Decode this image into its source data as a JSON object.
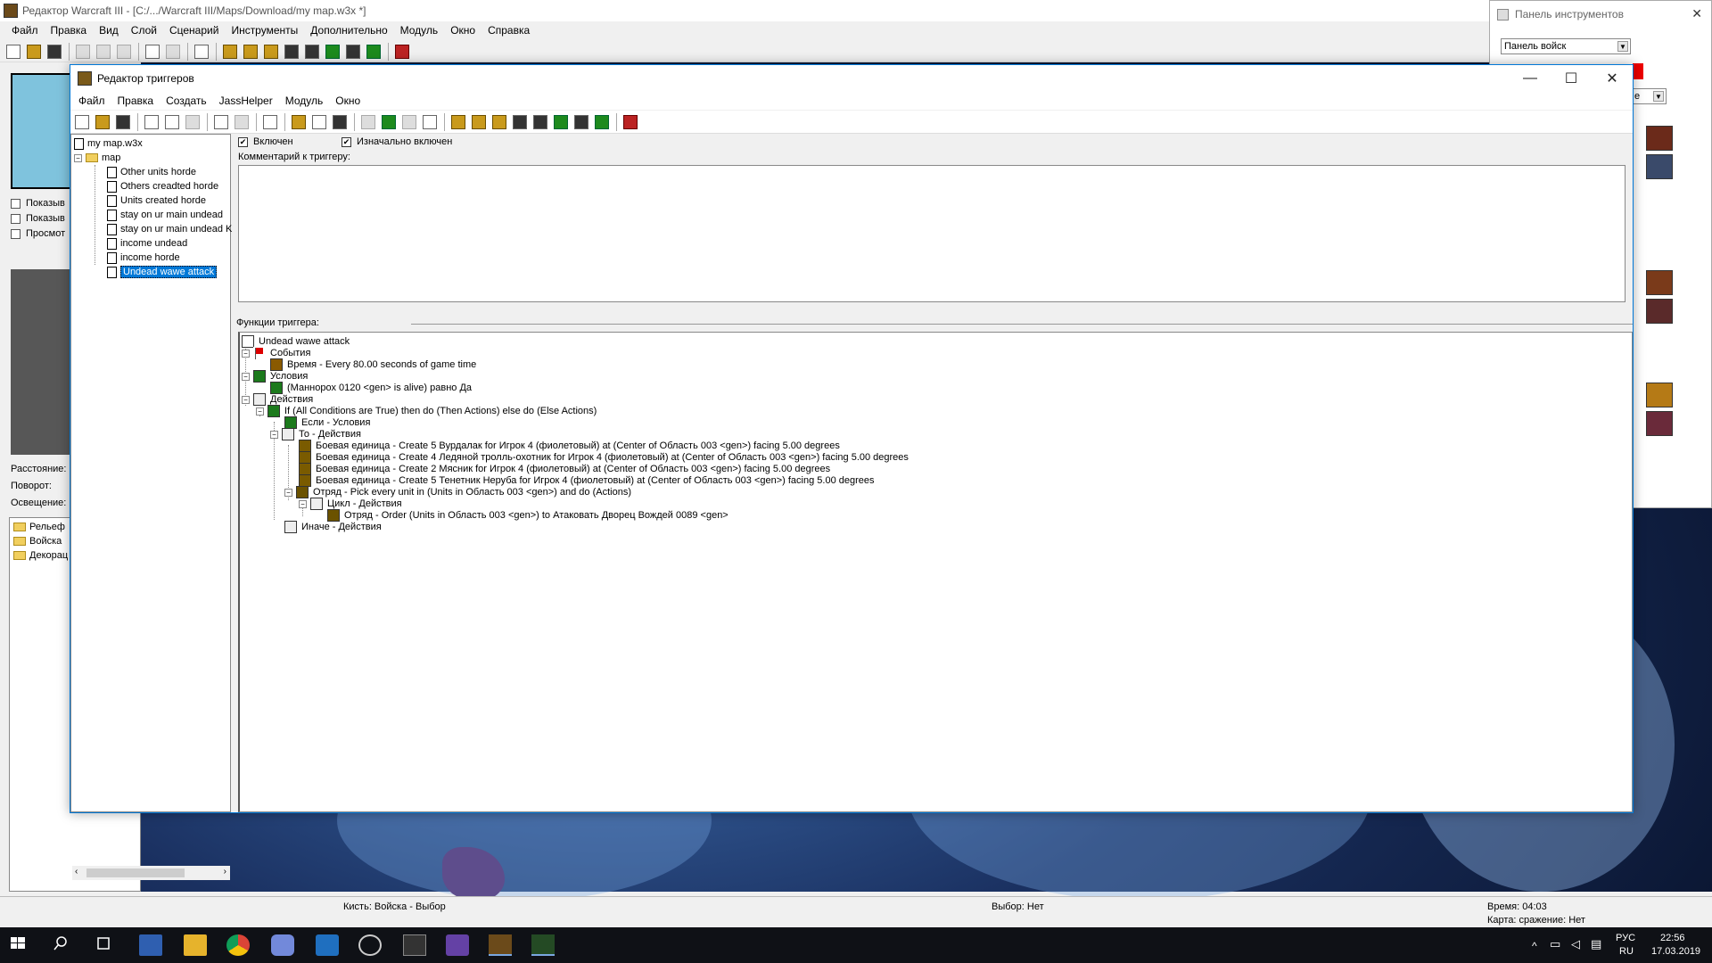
{
  "main_window": {
    "title": "Редактор Warcraft III  - [C:/.../Warcraft III/Maps/Download/my map.w3x *]",
    "menu": [
      "Файл",
      "Правка",
      "Вид",
      "Слой",
      "Сценарий",
      "Инструменты",
      "Дополнительно",
      "Модуль",
      "Окно",
      "Справка"
    ],
    "left_checks": [
      "Показыв",
      "Показыв",
      "Просмот"
    ],
    "props": [
      "Расстояние:",
      "Поворот:",
      "Освещение:"
    ],
    "palette": [
      "Рельеф",
      "Войска",
      "Декорац"
    ]
  },
  "tool_panel": {
    "title": "Панель инструментов",
    "select_value": "Панель войск",
    "second_select_fragment": "е"
  },
  "trigger_editor": {
    "title": "Редактор триггеров",
    "menu": [
      "Файл",
      "Правка",
      "Создать",
      "JassHelper",
      "Модуль",
      "Окно"
    ],
    "enabled_label": "Включен",
    "initially_on_label": "Изначально включен",
    "comment_label": "Комментарий к триггеру:",
    "functions_label": "Функции триггера:",
    "tree": {
      "root": "my map.w3x",
      "folder": "map",
      "triggers": [
        "Other units horde",
        "Others creadted horde",
        "Units created horde",
        "stay on ur main undead",
        "stay on ur main undead K",
        "income undead",
        "income horde",
        "Undead wawe attack"
      ]
    },
    "functions": {
      "trigger_name": "Undead wawe attack",
      "events_label": "События",
      "event_1": "Время - Every 80.00 seconds of game time",
      "conditions_label": "Условия",
      "condition_1": "(Маннорох 0120 <gen> is alive) равно Да",
      "actions_label": "Действия",
      "if_action": "If (All Conditions are True) then do (Then Actions) else do (Else Actions)",
      "if_conditions": "Если - Условия",
      "then_actions": "То - Действия",
      "unit_1": "Боевая единица - Create 5 Вурдалак for Игрок 4 (фиолетовый) at (Center of Область 003 <gen>) facing 5.00 degrees",
      "unit_2": "Боевая единица - Create 4 Ледяной тролль-охотник for Игрок 4 (фиолетовый) at (Center of Область 003 <gen>) facing 5.00 degrees",
      "unit_3": "Боевая единица - Create 2 Мясник for Игрок 4 (фиолетовый) at (Center of Область 003 <gen>) facing 5.00 degrees",
      "unit_4": "Боевая единица - Create 5 Тенетник Неруба for Игрок 4 (фиолетовый) at (Center of Область 003 <gen>) facing 5.00 degrees",
      "group_pick": "Отряд - Pick every unit in (Units in Область 003 <gen>) and do (Actions)",
      "loop_actions": "Цикл - Действия",
      "group_order": "Отряд - Order (Units in Область 003 <gen>) to Атаковать Дворец Вождей 0089 <gen>",
      "else_actions": "Иначе - Действия"
    }
  },
  "statusbar": {
    "brush": "Кисть: Войска - Выбор",
    "selection": "Выбор: Нет",
    "time": "Время: 04:03",
    "map": "Карта: сражение: Нет"
  },
  "taskbar": {
    "lang": "РУС",
    "lang_sub": "RU",
    "clock": "22:56",
    "date": "17.03.2019"
  },
  "colors": {
    "selection": "#0078d7",
    "taskbar": "#0f1116"
  }
}
